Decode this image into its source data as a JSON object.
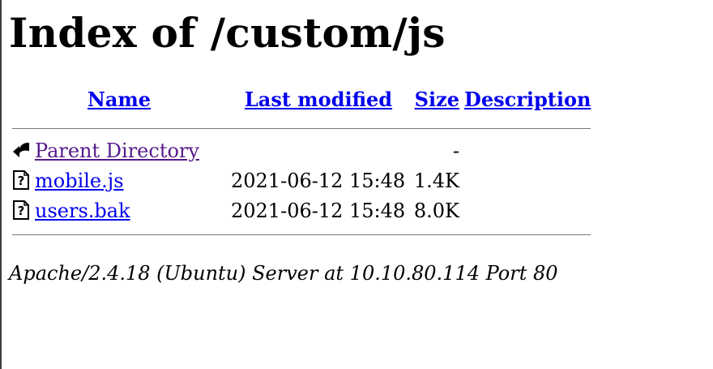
{
  "page": {
    "title": "Index of /custom/js"
  },
  "table": {
    "headers": {
      "name": "Name",
      "last_modified": "Last modified",
      "size": "Size",
      "description": "Description"
    },
    "rows": [
      {
        "icon": "back-arrow-icon",
        "name": "Parent Directory",
        "last_modified": "",
        "size": "-",
        "description": "",
        "visited": true
      },
      {
        "icon": "unknown-file-icon",
        "name": "mobile.js",
        "last_modified": "2021-06-12 15:48",
        "size": "1.4K",
        "description": "",
        "visited": false
      },
      {
        "icon": "unknown-file-icon",
        "name": "users.bak",
        "last_modified": "2021-06-12 15:48",
        "size": "8.0K",
        "description": "",
        "visited": false
      }
    ]
  },
  "footer": {
    "server_signature": "Apache/2.4.18 (Ubuntu) Server at 10.10.80.114 Port 80"
  },
  "colors": {
    "link": "#0000ee",
    "visited_link": "#551a8b",
    "rule": "#777777"
  }
}
